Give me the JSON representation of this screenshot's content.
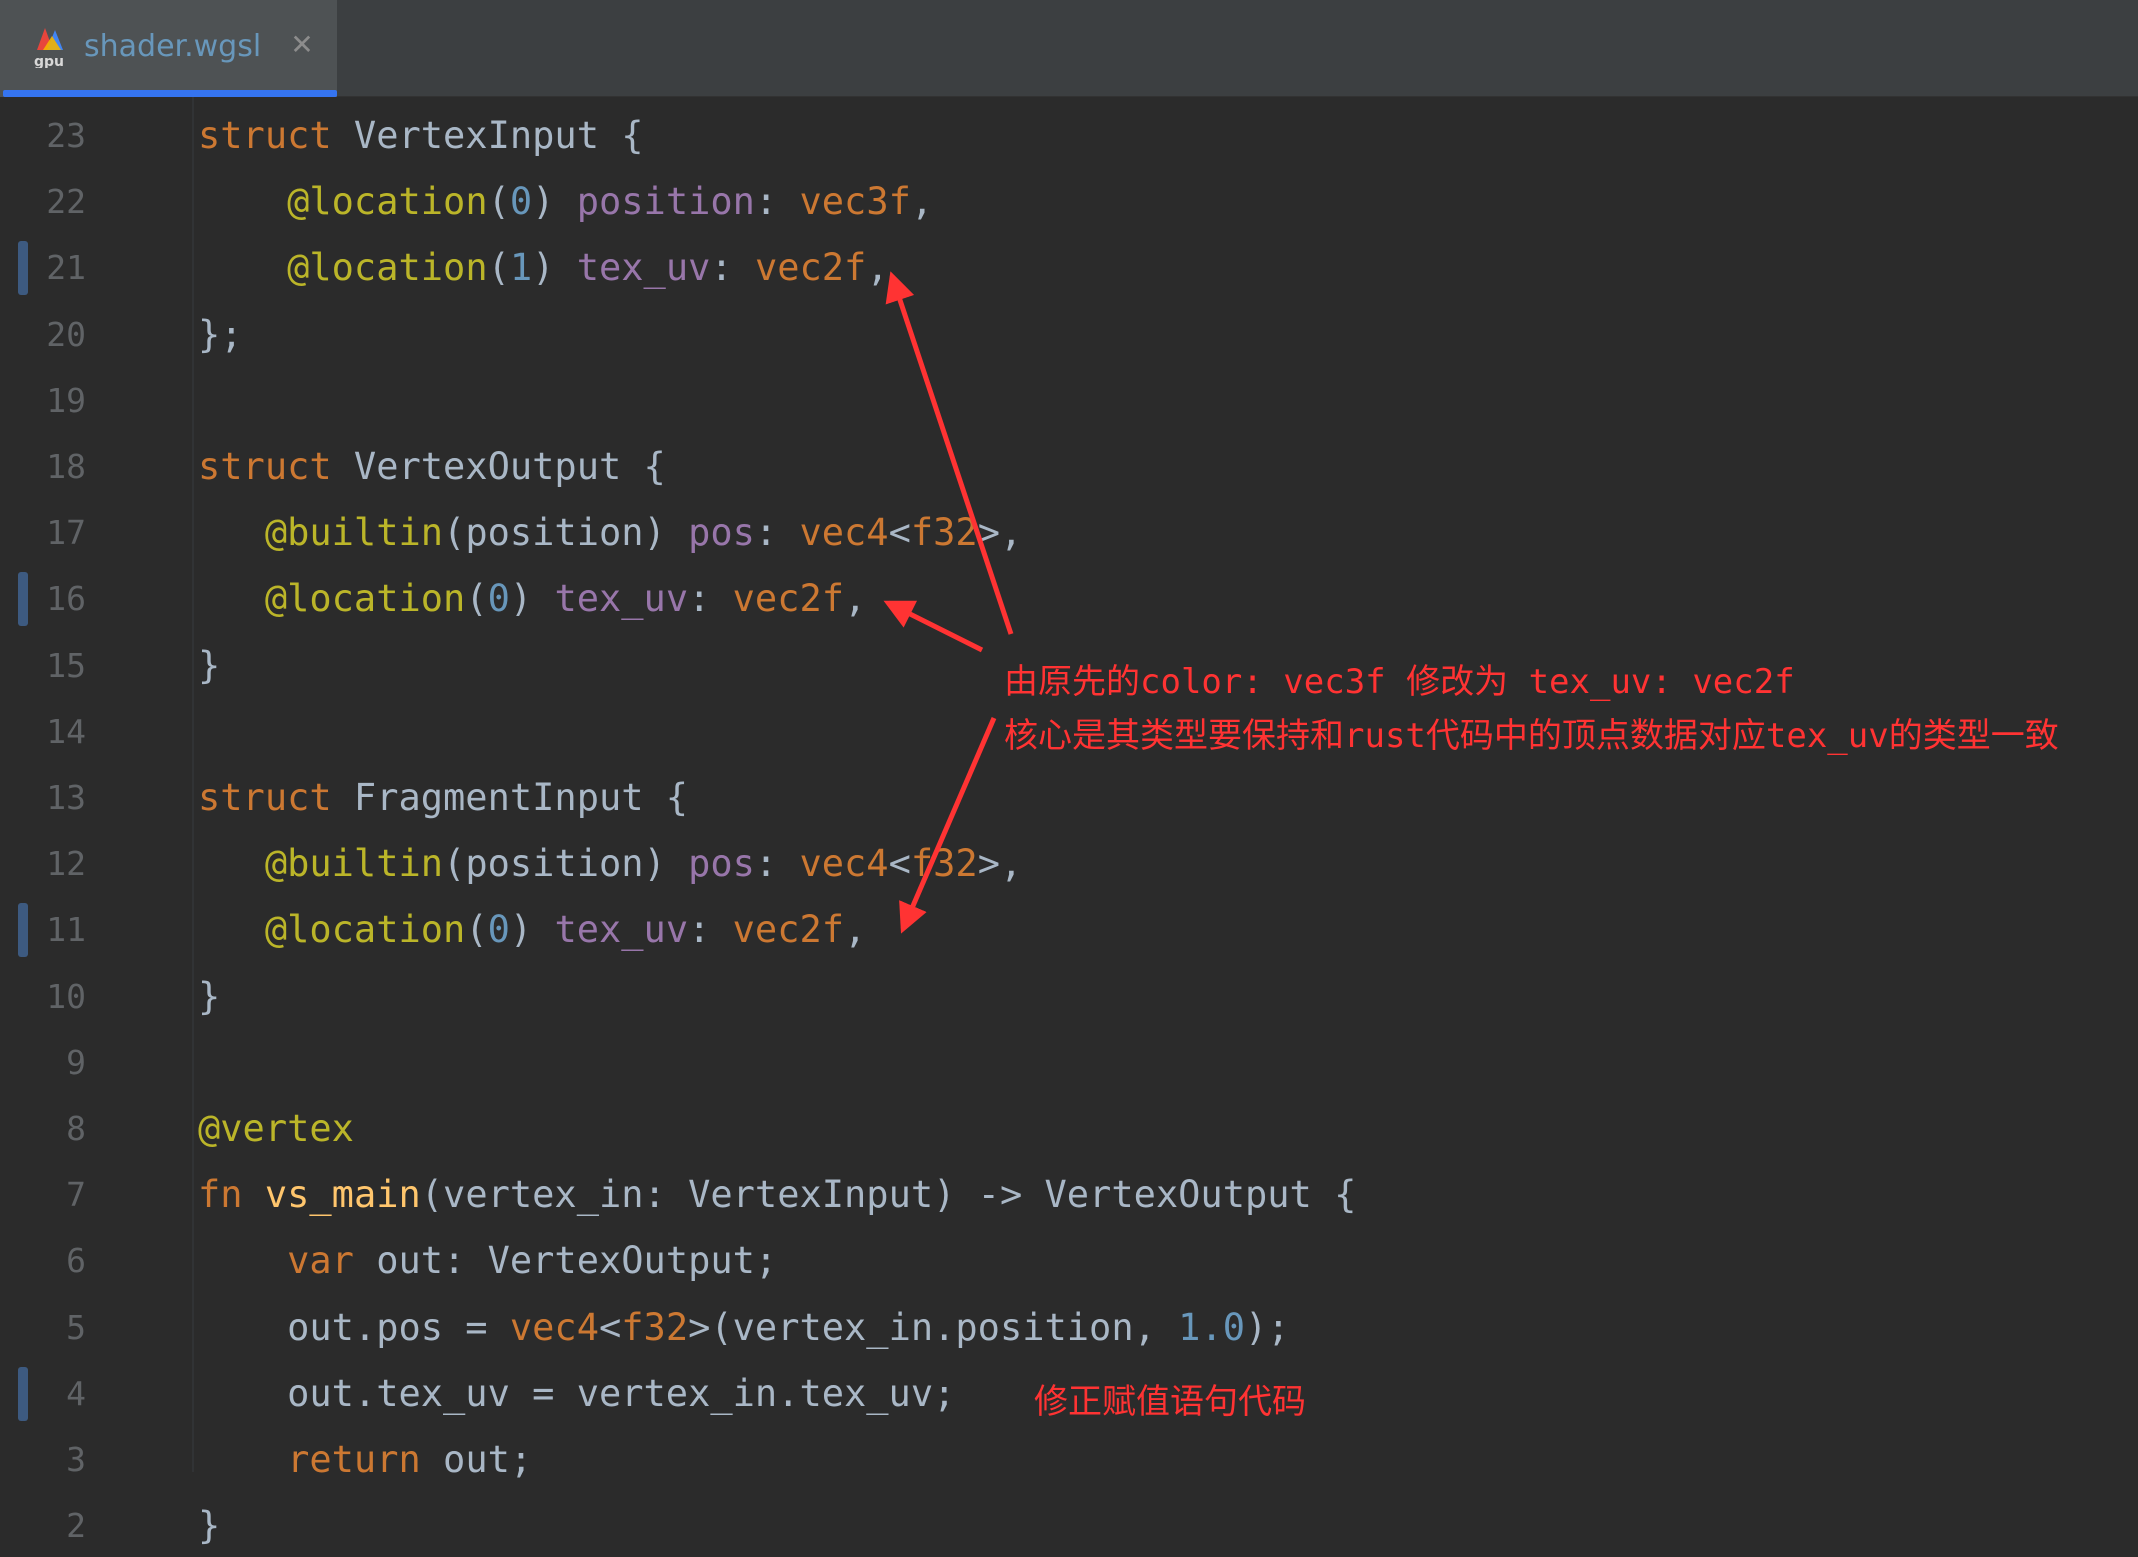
{
  "tab": {
    "icon_text": "gpu",
    "label": "shader.wgsl",
    "close_glyph": "✕"
  },
  "colors": {
    "editor_bg": "#2b2b2b",
    "tab_active_underline": "#3574f0",
    "annotation_red": "#ff3333",
    "keyword": "#cc7832",
    "attribute": "#bbb529",
    "field": "#9876aa",
    "number": "#6897bb",
    "function": "#ffc66d",
    "text": "#a9b7c6"
  },
  "line_numbers": [
    "23",
    "22",
    "21",
    "20",
    "19",
    "18",
    "17",
    "16",
    "15",
    "14",
    "13",
    "12",
    "11",
    "10",
    "9",
    "8",
    "7",
    "6",
    "5",
    "4",
    "3",
    "2"
  ],
  "changed_line_numbers": [
    "21",
    "16",
    "11",
    "4"
  ],
  "code_lines": [
    [
      [
        "kw",
        "struct"
      ],
      [
        "txt",
        " VertexInput {"
      ]
    ],
    [
      [
        "txt",
        "    "
      ],
      [
        "attr",
        "@location"
      ],
      [
        "txt",
        "("
      ],
      [
        "num",
        "0"
      ],
      [
        "txt",
        ") "
      ],
      [
        "fld",
        "position"
      ],
      [
        "txt",
        ": "
      ],
      [
        "kw",
        "vec3f"
      ],
      [
        "txt",
        ","
      ]
    ],
    [
      [
        "txt",
        "    "
      ],
      [
        "attr",
        "@location"
      ],
      [
        "txt",
        "("
      ],
      [
        "num",
        "1"
      ],
      [
        "txt",
        ") "
      ],
      [
        "fld",
        "tex_uv"
      ],
      [
        "txt",
        ": "
      ],
      [
        "kw",
        "vec2f"
      ],
      [
        "txt",
        ","
      ]
    ],
    [
      [
        "txt",
        "};"
      ]
    ],
    [
      [
        "txt",
        ""
      ]
    ],
    [
      [
        "kw",
        "struct"
      ],
      [
        "txt",
        " VertexOutput {"
      ]
    ],
    [
      [
        "txt",
        "   "
      ],
      [
        "attr",
        "@builtin"
      ],
      [
        "txt",
        "(position) "
      ],
      [
        "fld",
        "pos"
      ],
      [
        "txt",
        ": "
      ],
      [
        "kw",
        "vec4"
      ],
      [
        "txt",
        "<"
      ],
      [
        "kw",
        "f32"
      ],
      [
        "txt",
        ">,"
      ]
    ],
    [
      [
        "txt",
        "   "
      ],
      [
        "attr",
        "@location"
      ],
      [
        "txt",
        "("
      ],
      [
        "num",
        "0"
      ],
      [
        "txt",
        ") "
      ],
      [
        "fld",
        "tex_uv"
      ],
      [
        "txt",
        ": "
      ],
      [
        "kw",
        "vec2f"
      ],
      [
        "txt",
        ","
      ]
    ],
    [
      [
        "txt",
        "}"
      ]
    ],
    [
      [
        "txt",
        ""
      ]
    ],
    [
      [
        "kw",
        "struct"
      ],
      [
        "txt",
        " FragmentInput {"
      ]
    ],
    [
      [
        "txt",
        "   "
      ],
      [
        "attr",
        "@builtin"
      ],
      [
        "txt",
        "(position) "
      ],
      [
        "fld",
        "pos"
      ],
      [
        "txt",
        ": "
      ],
      [
        "kw",
        "vec4"
      ],
      [
        "txt",
        "<"
      ],
      [
        "kw",
        "f32"
      ],
      [
        "txt",
        ">,"
      ]
    ],
    [
      [
        "txt",
        "   "
      ],
      [
        "attr",
        "@location"
      ],
      [
        "txt",
        "("
      ],
      [
        "num",
        "0"
      ],
      [
        "txt",
        ") "
      ],
      [
        "fld",
        "tex_uv"
      ],
      [
        "txt",
        ": "
      ],
      [
        "kw",
        "vec2f"
      ],
      [
        "txt",
        ","
      ]
    ],
    [
      [
        "txt",
        "}"
      ]
    ],
    [
      [
        "txt",
        ""
      ]
    ],
    [
      [
        "attr",
        "@vertex"
      ]
    ],
    [
      [
        "kw",
        "fn"
      ],
      [
        "txt",
        " "
      ],
      [
        "fn",
        "vs_main"
      ],
      [
        "txt",
        "(vertex_in: VertexInput) -> VertexOutput {"
      ]
    ],
    [
      [
        "txt",
        "    "
      ],
      [
        "kw",
        "var"
      ],
      [
        "txt",
        " out: VertexOutput;"
      ]
    ],
    [
      [
        "txt",
        "    out.pos = "
      ],
      [
        "kw",
        "vec4"
      ],
      [
        "txt",
        "<"
      ],
      [
        "kw",
        "f32"
      ],
      [
        "txt",
        ">(vertex_in.position, "
      ],
      [
        "num",
        "1.0"
      ],
      [
        "txt",
        ");"
      ]
    ],
    [
      [
        "txt",
        "    out.tex_uv = vertex_in.tex_uv;"
      ]
    ],
    [
      [
        "txt",
        "    "
      ],
      [
        "kw",
        "return"
      ],
      [
        "txt",
        " out;"
      ]
    ],
    [
      [
        "txt",
        "}"
      ]
    ]
  ],
  "annotations": {
    "main_line1": "由原先的color: vec3f 修改为 tex_uv: vec2f",
    "main_line2": "核心是其类型要保持和rust代码中的顶点数据对应tex_uv的类型一致",
    "assignment_note": "修正赋值语句代码"
  }
}
